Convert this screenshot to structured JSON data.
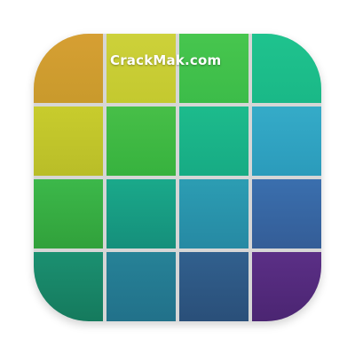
{
  "watermark": {
    "text": "CrackMak.com"
  },
  "tiles": [
    {
      "name": "tile-1-1",
      "top": "#d69f33",
      "bottom": "#c99a2c"
    },
    {
      "name": "tile-1-2",
      "top": "#cdd13a",
      "bottom": "#c4c92f"
    },
    {
      "name": "tile-1-3",
      "top": "#47c64e",
      "bottom": "#3cbc49"
    },
    {
      "name": "tile-1-4",
      "top": "#1fc38e",
      "bottom": "#1ab887"
    },
    {
      "name": "tile-2-1",
      "top": "#c8cc2d",
      "bottom": "#b9bd28"
    },
    {
      "name": "tile-2-2",
      "top": "#47bf48",
      "bottom": "#37b23e"
    },
    {
      "name": "tile-2-3",
      "top": "#1dbb8c",
      "bottom": "#17ab84"
    },
    {
      "name": "tile-2-4",
      "top": "#35abc8",
      "bottom": "#2b9bbb"
    },
    {
      "name": "tile-3-1",
      "top": "#3cb84a",
      "bottom": "#31a13b"
    },
    {
      "name": "tile-3-2",
      "top": "#1aa98a",
      "bottom": "#158f7b"
    },
    {
      "name": "tile-3-3",
      "top": "#2c9db3",
      "bottom": "#2689a3"
    },
    {
      "name": "tile-3-4",
      "top": "#3a6fae",
      "bottom": "#345d97"
    },
    {
      "name": "tile-4-1",
      "top": "#1b9071",
      "bottom": "#157a5d"
    },
    {
      "name": "tile-4-2",
      "top": "#268297",
      "bottom": "#22718a"
    },
    {
      "name": "tile-4-3",
      "top": "#31608e",
      "bottom": "#2a4f79"
    },
    {
      "name": "tile-4-4",
      "top": "#5b2f86",
      "bottom": "#4b2572"
    }
  ]
}
